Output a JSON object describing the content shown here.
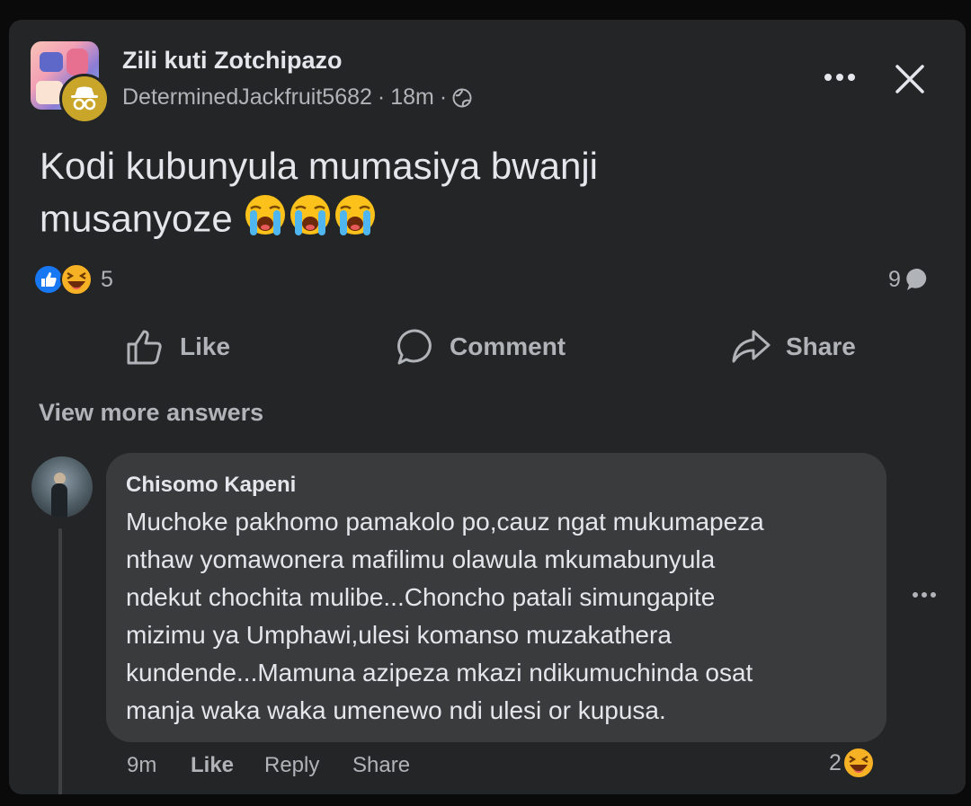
{
  "post": {
    "group_name": "Zili kuti Zotchipazo",
    "author": "DeterminedJackfruit5682",
    "time": "18m",
    "separator": "·",
    "text_line1": "Kodi kubunyula mumasiya bwanji",
    "text_line2": "musanyoze",
    "reaction_count": "5",
    "comment_count": "9",
    "reactions": [
      "like",
      "haha"
    ],
    "emojis": [
      "loudly-crying-face",
      "loudly-crying-face",
      "loudly-crying-face"
    ]
  },
  "actions": {
    "like": "Like",
    "comment": "Comment",
    "share": "Share"
  },
  "view_more": "View more answers",
  "comment": {
    "name": "Chisomo Kapeni",
    "lines": [
      "Muchoke pakhomo pamakolo po,cauz ngat mukumapeza",
      "nthaw yomawonera mafilimu olawula mkumabunyula",
      "ndekut chochita mulibe...Choncho patali simungapite",
      "mizimu ya Umphawi,ulesi komanso muzakathera",
      "kundende...Mamuna azipeza mkazi ndikumuchinda osat",
      "manja waka waka umenewo ndi ulesi or kupusa."
    ],
    "time": "9m",
    "like": "Like",
    "reply": "Reply",
    "share": "Share",
    "reaction_count": "2"
  },
  "colors": {
    "card": "#242526",
    "bubble": "#3a3b3c",
    "text": "#e4e6eb",
    "muted": "#b0b3b8",
    "like_blue": "#1877f2",
    "haha_yellow": "#f7b125"
  }
}
